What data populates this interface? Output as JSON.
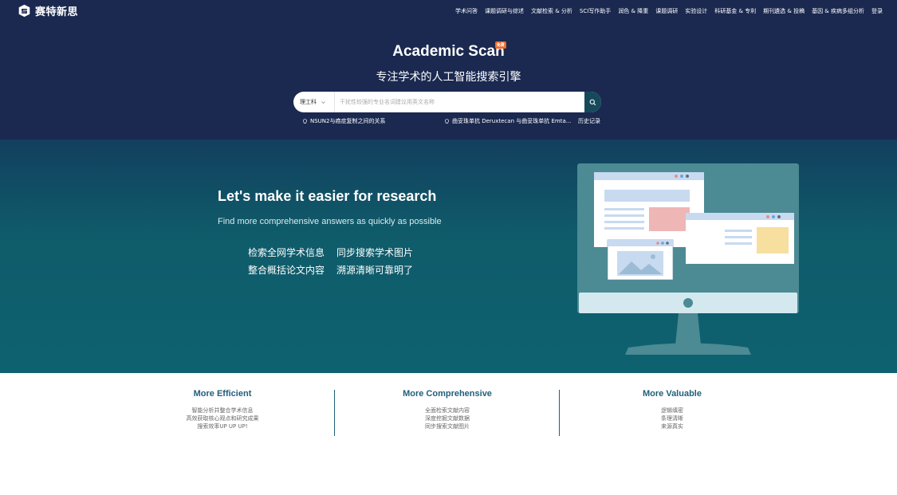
{
  "header": {
    "logo_text": "赛特新思",
    "nav": [
      "学术问答",
      "课题调研与综述",
      "文献检索 & 分析",
      "SCI写作助手",
      "润色 & 降重",
      "课题调研",
      "实验设计",
      "科研基金 & 专利",
      "期刊遴选 & 投稿",
      "基因 & 疾病多组分析",
      "登录"
    ]
  },
  "search_section": {
    "brand": "Academic Scan",
    "free_badge": "免费",
    "tagline": "专注学术的人工智能搜索引擎",
    "field_selector": "理工科",
    "placeholder": "干扰性较强的专业名词建议用英文名称",
    "suggestions": [
      "NSUN2与癌症复制之间的关系",
      "曲妥珠单抗 Deruxtecan 与曲妥珠单抗 Emta..."
    ],
    "history_label": "历史记录"
  },
  "hero": {
    "title": "Let's make it easier for research",
    "subtitle": "Find more comprehensive answers as quickly as possible",
    "features": [
      "检索全网学术信息",
      "同步搜索学术图片",
      "整合概括论文内容",
      "溯源清晰可靠明了"
    ]
  },
  "columns": [
    {
      "title": "More Efficient",
      "lines": [
        "智能分析并整合学术信息",
        "高效获取核心观点和研究成果",
        "搜索效率UP UP UP!"
      ]
    },
    {
      "title": "More Comprehensive",
      "lines": [
        "全面检索文献内容",
        "深度挖掘文献数据",
        "同步搜索文献图片"
      ]
    },
    {
      "title": "More Valuable",
      "lines": [
        "逻辑缜密",
        "条理清晰",
        "来源真实"
      ]
    }
  ],
  "colors": {
    "header_bg": "#1b2950",
    "hero_bg": "#0f5b6a",
    "accent": "#1f5f7a",
    "badge": "#ef6a2a",
    "search_button": "#164a5b"
  }
}
